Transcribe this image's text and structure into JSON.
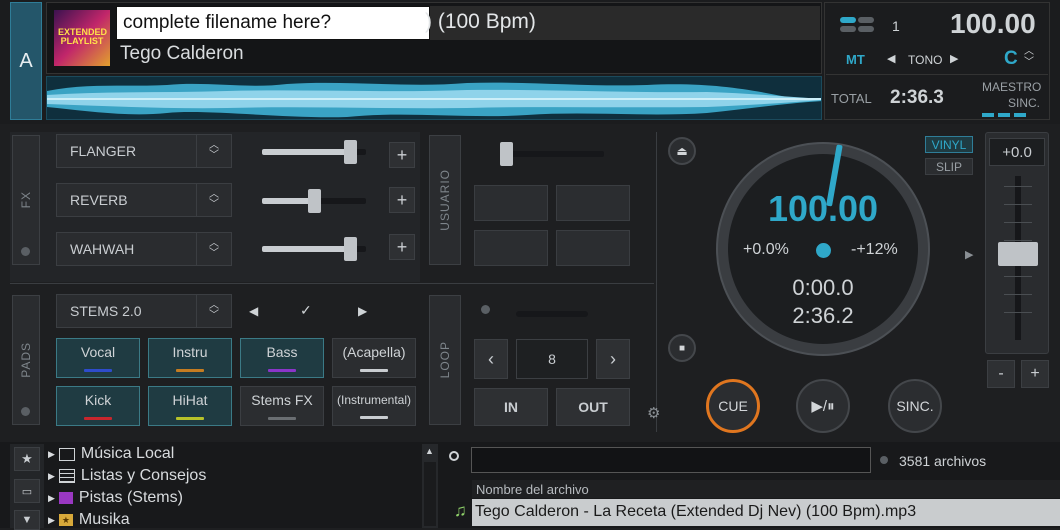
{
  "deck": {
    "letter": "A",
    "title_overlay": "complete filename here?",
    "title_suffix": ") (100 Bpm)",
    "artist": "Tego Calderon",
    "cover_text": "EXTENDED PLAYLIST",
    "key_index": "1",
    "bpm": "100.00",
    "mt_label": "MT",
    "tono_label": "TONO",
    "key": "C",
    "total_label": "TOTAL",
    "total_time": "2:36.3",
    "maestro_label": "MAESTRO",
    "sinc_label": "SINC."
  },
  "fx": {
    "label": "FX",
    "slots": [
      {
        "name": "FLANGER",
        "level": 0.9
      },
      {
        "name": "REVERB",
        "level": 0.5
      },
      {
        "name": "WAHWAH",
        "level": 0.9
      }
    ],
    "plus": "+"
  },
  "usuario": {
    "label": "USUARIO"
  },
  "pads": {
    "label": "PADS",
    "mode": "STEMS 2.0",
    "prev": "◀",
    "check": "✓",
    "next": "▶",
    "row1": [
      {
        "label": "Vocal",
        "color": "#2e4ccc",
        "active": true
      },
      {
        "label": "Instru",
        "color": "#c57c21",
        "active": true
      },
      {
        "label": "Bass",
        "color": "#8a35c9",
        "active": true
      },
      {
        "label": "(Acapella)",
        "color": "#c9cdd1",
        "active": false
      }
    ],
    "row2": [
      {
        "label": "Kick",
        "color": "#c8262d",
        "active": true
      },
      {
        "label": "HiHat",
        "color": "#b7c22a",
        "active": true
      },
      {
        "label": "Stems FX",
        "color": "#6a6e72",
        "active": false
      },
      {
        "label": "(Instrumental)",
        "color": "#c9cdd1",
        "active": false
      }
    ]
  },
  "loop": {
    "label": "LOOP",
    "size": "8",
    "in_label": "IN",
    "out_label": "OUT"
  },
  "platter": {
    "bpm": "100.00",
    "pitch": "+0.0%",
    "range": "-+12%",
    "elapsed": "0:00.0",
    "remaining": "2:36.2"
  },
  "controls": {
    "vinyl": "VINYL",
    "slip": "SLIP",
    "pitch_value": "+0.0",
    "minus": "-",
    "plus": "+",
    "cue": "CUE",
    "play": "▶/⏸",
    "sinc": "SINC."
  },
  "browser": {
    "tree": [
      {
        "label": "Música Local",
        "icon": "monitor-icon"
      },
      {
        "label": "Listas y Consejos",
        "icon": "list-icon"
      },
      {
        "label": "Pistas (Stems)",
        "icon": "stems-icon"
      },
      {
        "label": "Musika",
        "icon": "folder-star-icon"
      }
    ],
    "search_placeholder": "",
    "file_count": "3581 archivos",
    "column_header": "Nombre del archivo",
    "rows": [
      "Tego Calderon - La Receta (Extended Dj Nev) (100 Bpm).mp3"
    ]
  },
  "colors": {
    "accent": "#2fa8c9",
    "cue_ring": "#e0761f"
  }
}
